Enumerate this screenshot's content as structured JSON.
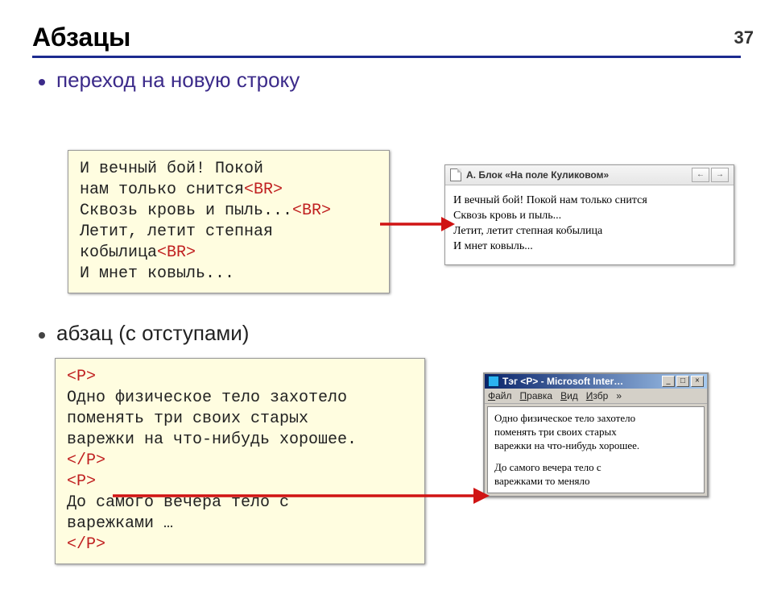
{
  "page_number": "37",
  "title": "Абзацы",
  "bullets": {
    "newline": "переход на новую строку",
    "paragraph": "абзац (с отступами)"
  },
  "code1": {
    "l1": "И вечный бой! Покой",
    "l2a": "нам только снится",
    "l2b": "<BR>",
    "l3a": "Сквозь кровь и пыль...",
    "l3b": "<BR>",
    "l4": "Летит, летит степная",
    "l5a": "кобылица",
    "l5b": "<BR>",
    "l6": "И мнет ковыль..."
  },
  "preview1": {
    "tab_title": "А. Блок  «На поле Куликовом»",
    "nav_back": "←",
    "nav_fwd": "→",
    "line1": "И вечный бой! Покой нам только снится",
    "line2": "Сквозь кровь и пыль...",
    "line3": "Летит, летит степная кобылица",
    "line4": "И мнет ковыль..."
  },
  "code2": {
    "p_open": "<P>",
    "t1": "Одно физическое тело захотело",
    "t2": "поменять три своих старых",
    "t3": "варежки на что-нибудь хорошее.",
    "p_close": "</P>",
    "p_open2": "<P>",
    "t4": "До самого вечера тело с",
    "t5": "варежками …",
    "p_close2": "</P>"
  },
  "win": {
    "title": "Тэг <P> - Microsoft Inter…",
    "menu": {
      "file": "Файл",
      "edit": "Правка",
      "view": "Вид",
      "fav": "Избр",
      "more": "»"
    },
    "btn_min": "_",
    "btn_max": "□",
    "btn_close": "×",
    "para1a": "Одно физическое тело захотело",
    "para1b": "поменять три своих старых",
    "para1c": "варежки на что-нибудь хорошее.",
    "para2a": "До самого вечера тело с",
    "para2b": "варежками то меняло"
  }
}
